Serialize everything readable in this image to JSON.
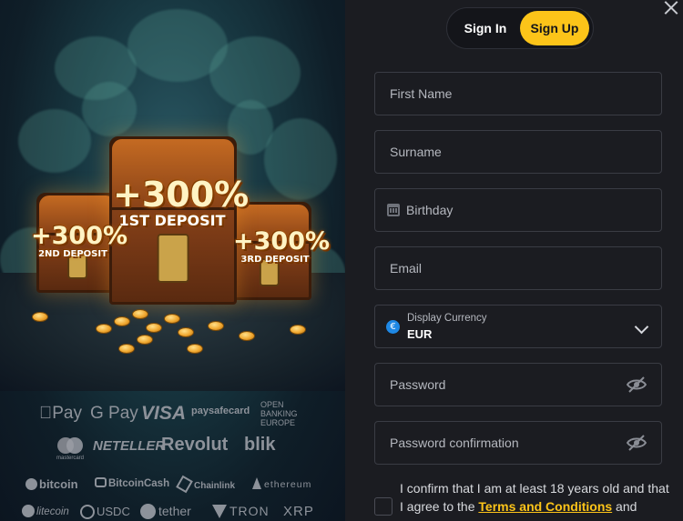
{
  "promo": {
    "bonuses": [
      {
        "percent": "+300%",
        "label": "1ST DEPOSIT"
      },
      {
        "percent": "+300%",
        "label": "2ND DEPOSIT"
      },
      {
        "percent": "+300%",
        "label": "3RD DEPOSIT"
      }
    ],
    "payment_logos": {
      "row1": [
        "Pay",
        "G Pay",
        "VISA",
        "paysafecard",
        "OPEN BANKING EUROPE"
      ],
      "row2": [
        "mastercard",
        "NETELLER",
        "Revolut",
        "blik"
      ],
      "row3": [
        "bitcoin",
        "BitcoinCash",
        "Chainlink",
        "ethereum"
      ],
      "row4": [
        "litecoin",
        "USDC",
        "tether",
        "TRON",
        "XRP"
      ]
    }
  },
  "auth": {
    "tabs": [
      {
        "label": "Sign In",
        "active": false
      },
      {
        "label": "Sign Up",
        "active": true
      }
    ],
    "fields": {
      "first_name": {
        "placeholder": "First Name"
      },
      "surname": {
        "placeholder": "Surname"
      },
      "birthday": {
        "placeholder": "Birthday"
      },
      "email": {
        "placeholder": "Email"
      },
      "currency": {
        "label": "Display Currency",
        "value": "EUR",
        "icon": "euro-coin-icon"
      },
      "password": {
        "placeholder": "Password"
      },
      "password_confirm": {
        "placeholder": "Password confirmation"
      }
    },
    "consent": {
      "text_before": "I confirm that I am at least 18 years old and that I agree to the ",
      "link": "Terms and Conditions",
      "text_after": " and"
    }
  },
  "colors": {
    "accent": "#fcc419",
    "panel_bg": "#1b1c21",
    "field_border": "#3a3c44"
  }
}
